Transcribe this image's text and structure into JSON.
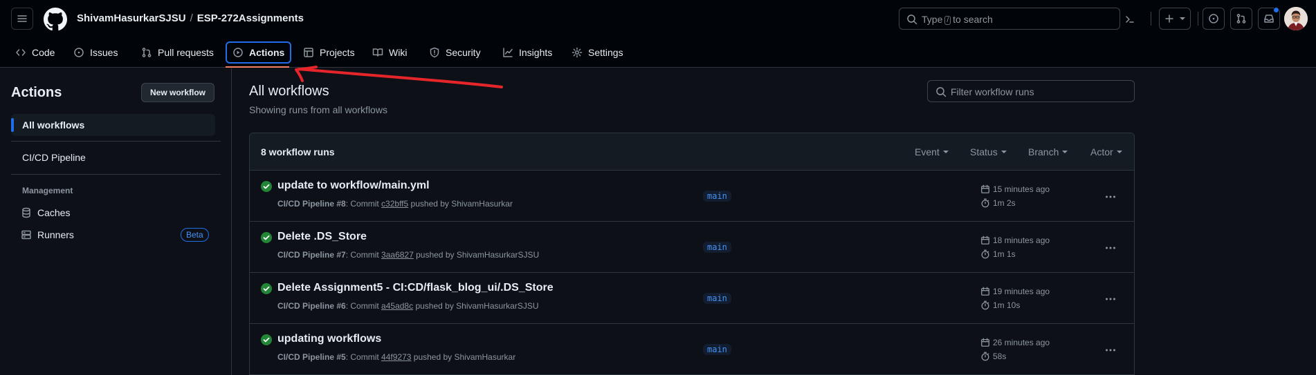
{
  "header": {
    "owner": "ShivamHasurkarSJSU",
    "separator": "/",
    "repo": "ESP-272Assignments",
    "search_prefix": "Type",
    "search_key": "/",
    "search_suffix": "to search"
  },
  "nav": {
    "tabs": [
      {
        "label": "Code",
        "icon": "code-icon"
      },
      {
        "label": "Issues",
        "icon": "issue-icon"
      },
      {
        "label": "Pull requests",
        "icon": "pull-request-icon"
      },
      {
        "label": "Actions",
        "icon": "play-icon",
        "active": true
      },
      {
        "label": "Projects",
        "icon": "table-icon"
      },
      {
        "label": "Wiki",
        "icon": "book-icon"
      },
      {
        "label": "Security",
        "icon": "shield-icon"
      },
      {
        "label": "Insights",
        "icon": "graph-icon"
      },
      {
        "label": "Settings",
        "icon": "gear-icon"
      }
    ]
  },
  "sidebar": {
    "title": "Actions",
    "new_workflow": "New workflow",
    "all_workflows": "All workflows",
    "workflow": "CI/CD Pipeline",
    "management_heading": "Management",
    "caches": "Caches",
    "runners": "Runners",
    "beta": "Beta"
  },
  "main": {
    "title": "All workflows",
    "subtitle": "Showing runs from all workflows",
    "filter_placeholder": "Filter workflow runs",
    "runs_count": "8 workflow runs",
    "filters": [
      "Event",
      "Status",
      "Branch",
      "Actor"
    ]
  },
  "runs": [
    {
      "title": "update to workflow/main.yml",
      "workflow": "CI/CD Pipeline #8",
      "commit_label": ": Commit",
      "sha": "c32bff5",
      "pushed_by": "pushed by ShivamHasurkar",
      "branch": "main",
      "time": "15 minutes ago",
      "duration": "1m 2s"
    },
    {
      "title": "Delete .DS_Store",
      "workflow": "CI/CD Pipeline #7",
      "commit_label": ": Commit",
      "sha": "3aa6827",
      "pushed_by": "pushed by ShivamHasurkarSJSU",
      "branch": "main",
      "time": "18 minutes ago",
      "duration": "1m 1s"
    },
    {
      "title": "Delete Assignment5 - CI:CD/flask_blog_ui/.DS_Store",
      "workflow": "CI/CD Pipeline #6",
      "commit_label": ": Commit",
      "sha": "a45ad8c",
      "pushed_by": "pushed by ShivamHasurkarSJSU",
      "branch": "main",
      "time": "19 minutes ago",
      "duration": "1m 10s"
    },
    {
      "title": "updating workflows",
      "workflow": "CI/CD Pipeline #5",
      "commit_label": ": Commit",
      "sha": "44f9273",
      "pushed_by": "pushed by ShivamHasurkar",
      "branch": "main",
      "time": "26 minutes ago",
      "duration": "58s"
    }
  ],
  "colors": {
    "accent": "#1f6feb",
    "success": "#238636",
    "annotation": "#e5252a",
    "tab_underline": "#f78166"
  }
}
